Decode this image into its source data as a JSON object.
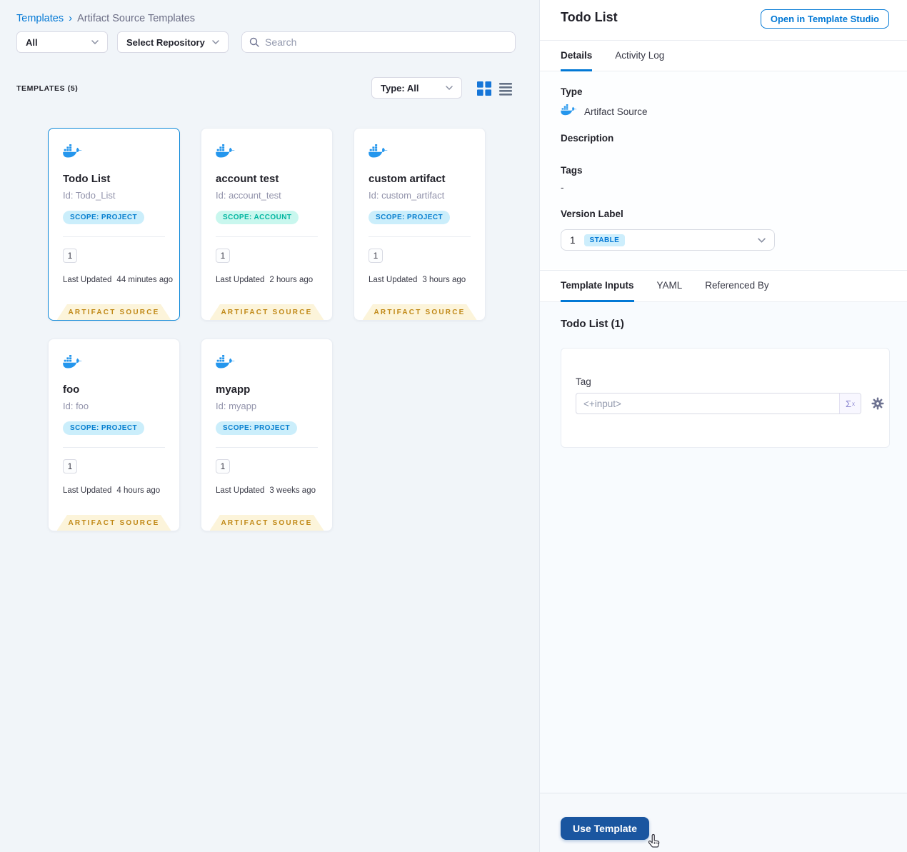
{
  "breadcrumb": {
    "root": "Templates",
    "separator": "›",
    "current": "Artifact Source Templates"
  },
  "filters": {
    "scope_dropdown": "All",
    "repository_dropdown": "Select Repository",
    "search_placeholder": "Search"
  },
  "toolbar": {
    "count_label": "TEMPLATES (5)",
    "type_dropdown": "Type: All"
  },
  "labels": {
    "last_updated": "Last Updated"
  },
  "cards": [
    {
      "title": "Todo List",
      "id_line": "Id: Todo_List",
      "scope": "SCOPE: PROJECT",
      "scope_type": "project",
      "version_count": "1",
      "last_updated": "44 minutes ago",
      "ribbon": "ARTIFACT SOURCE",
      "selected": true
    },
    {
      "title": "account test",
      "id_line": "Id: account_test",
      "scope": "SCOPE: ACCOUNT",
      "scope_type": "account",
      "version_count": "1",
      "last_updated": "2 hours ago",
      "ribbon": "ARTIFACT SOURCE",
      "selected": false
    },
    {
      "title": "custom artifact",
      "id_line": "Id: custom_artifact",
      "scope": "SCOPE: PROJECT",
      "scope_type": "project",
      "version_count": "1",
      "last_updated": "3 hours ago",
      "ribbon": "ARTIFACT SOURCE",
      "selected": false
    },
    {
      "title": "foo",
      "id_line": "Id: foo",
      "scope": "SCOPE: PROJECT",
      "scope_type": "project",
      "version_count": "1",
      "last_updated": "4 hours ago",
      "ribbon": "ARTIFACT SOURCE",
      "selected": false
    },
    {
      "title": "myapp",
      "id_line": "Id: myapp",
      "scope": "SCOPE: PROJECT",
      "scope_type": "project",
      "version_count": "1",
      "last_updated": "3 weeks ago",
      "ribbon": "ARTIFACT SOURCE",
      "selected": false
    }
  ],
  "panel": {
    "title": "Todo List",
    "open_button": "Open in Template Studio",
    "tabs": {
      "details": "Details",
      "activity_log": "Activity Log"
    },
    "details": {
      "type_label": "Type",
      "type_value": "Artifact Source",
      "description_label": "Description",
      "tags_label": "Tags",
      "tags_value": "-",
      "version_label": "Version Label",
      "version_value": "1",
      "version_badge": "STABLE"
    },
    "inner_tabs": {
      "template_inputs": "Template Inputs",
      "yaml": "YAML",
      "referenced_by": "Referenced By"
    },
    "inputs": {
      "section_title": "Todo List (1)",
      "tag_label": "Tag",
      "tag_value": "<+input>",
      "expression_icon": "Σ",
      "expression_sup": "x"
    },
    "footer": {
      "use_template_button": "Use Template"
    }
  },
  "colors": {
    "accent": "#0278d5",
    "docker_blue": "#2496ed",
    "ribbon_bg": "#fcf4da",
    "ribbon_text": "#c08816",
    "scope_project_bg": "#cbeefb",
    "scope_project_text": "#0980d0",
    "scope_account_bg": "#c9f7ee",
    "scope_account_text": "#00b5a0",
    "stable_badge_bg": "#cdeefc",
    "use_template_bg": "#1a56a0",
    "left_panel_bg": "#f1f5f9",
    "right_content_bg": "#f8fbfe"
  }
}
